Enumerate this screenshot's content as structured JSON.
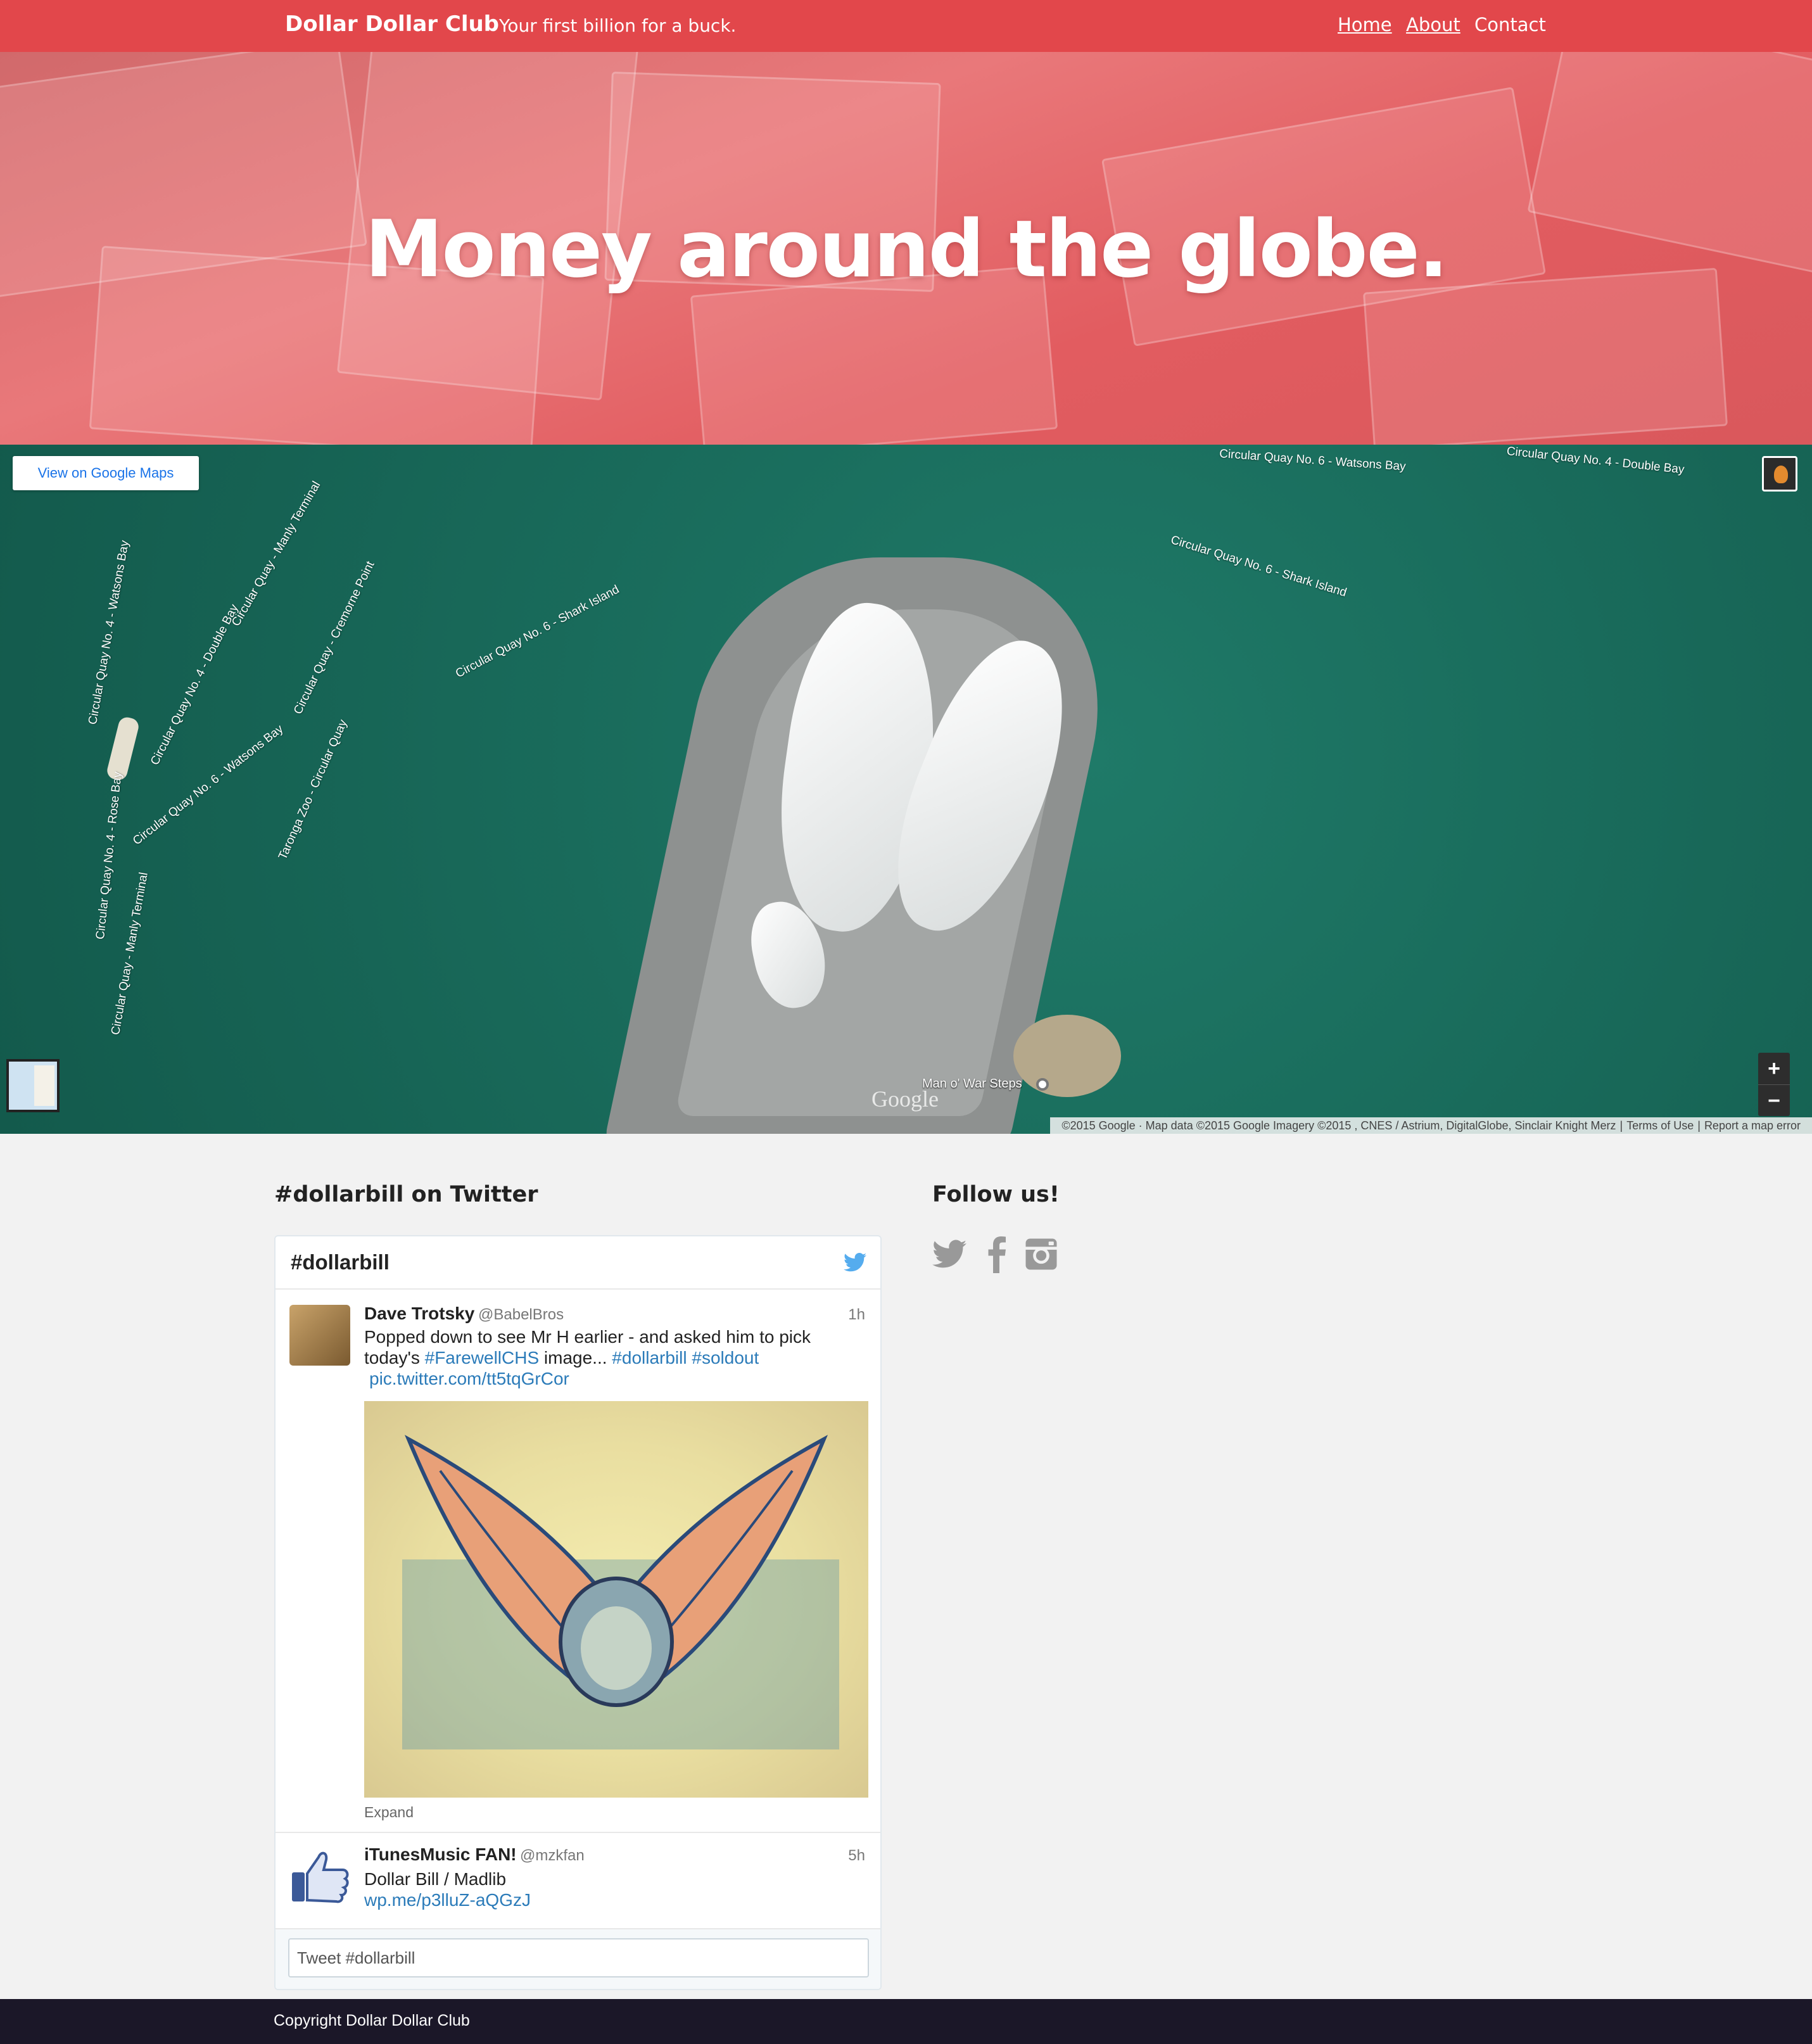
{
  "navbar": {
    "brand": "Dollar Dollar Club",
    "tagline": "Your first billion for a buck.",
    "links": [
      {
        "label": "Home"
      },
      {
        "label": "About"
      },
      {
        "label": "Contact"
      }
    ]
  },
  "hero": {
    "title": "Money around the globe."
  },
  "map": {
    "view_button": "View on Google Maps",
    "labels": [
      "Circular Quay No. 6 - Watsons Bay",
      "Circular Quay No. 4 - Double Bay",
      "Circular Quay No. 6 - Shark Island",
      "Circular Quay No. 6 - Shark Island",
      "Circular Quay No. 4 - Watsons Bay",
      "Circular Quay - Manly Terminal",
      "Circular Quay No. 4 - Double Bay",
      "Circular Quay - Cremorne Point",
      "Circular Quay No. 6 - Watsons Bay",
      "Taronga Zoo - Circular Quay",
      "Circular Quay No. 4 - Rose Bay",
      "Circular Quay - Manly Terminal"
    ],
    "place": "Man o' War Steps",
    "logo": "Google",
    "attribution": "©2015 Google · Map data ©2015 Google Imagery ©2015 , CNES / Astrium, DigitalGlobe, Sinclair Knight Merz",
    "terms": "Terms of Use",
    "report": "Report a map error",
    "zoom_in": "+",
    "zoom_out": "−"
  },
  "twitter": {
    "section_heading": "#dollarbill on Twitter",
    "widget_title": "#dollarbill",
    "tweets": [
      {
        "author": "Dave Trotsky",
        "handle": "@BabelBros",
        "time": "1h",
        "text_line1": "Popped down to see Mr H earlier - and asked him to pick",
        "text_line2_pre": "today's ",
        "hashtag1": "#FarewellCHS",
        "text_line2_mid": " image... ",
        "hashtag2": "#dollarbill",
        "hashtag3": "#soldout",
        "link": "pic.twitter.com/tt5tqGrCor",
        "expand": "Expand"
      },
      {
        "author": "iTunesMusic FAN!",
        "handle": "@mzkfan",
        "time": "5h",
        "text": "Dollar Bill / Madlib",
        "link": "wp.me/p3lluZ-aQGzJ"
      }
    ],
    "compose_placeholder": "Tweet #dollarbill"
  },
  "follow": {
    "heading": "Follow us!",
    "icons": [
      "twitter-icon",
      "facebook-icon",
      "instagram-icon"
    ]
  },
  "footer": {
    "copyright": "Copyright Dollar Dollar Club"
  },
  "colors": {
    "navbar": "#e2474b",
    "footer": "#1b1728",
    "link": "#2b7bb9",
    "social_icon": "#999999"
  }
}
